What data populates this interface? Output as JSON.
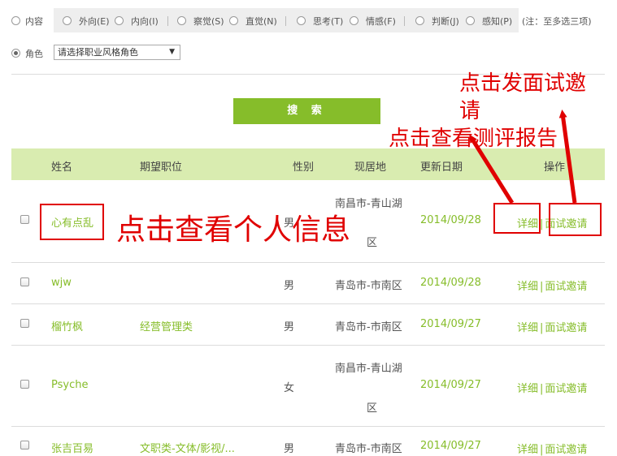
{
  "filter": {
    "content_label": "内容",
    "options": [
      "外向(E)",
      "内向(I)",
      "察觉(S)",
      "直觉(N)",
      "思考(T)",
      "情感(F)",
      "判断(J)",
      "感知(P)"
    ],
    "note": "(注：至多选三项)",
    "role_label": "角色",
    "role_select_value": "请选择职业风格角色"
  },
  "search_label": "搜 索",
  "table": {
    "headers": [
      "姓名",
      "期望职位",
      "性别",
      "现居地",
      "更新日期",
      "操作"
    ],
    "rows": [
      {
        "name": "心有点乱",
        "job": "",
        "gender": "男",
        "location_line1": "南昌市-青山湖",
        "location_line2": "区",
        "date": "2014/09/28",
        "detail": "详细",
        "invite": "面试邀请"
      },
      {
        "name": "wjw",
        "job": "",
        "gender": "男",
        "location": "青岛市-市南区",
        "date": "2014/09/28",
        "detail": "详细",
        "invite": "面试邀请"
      },
      {
        "name": "榴竹枫",
        "job": "经营管理类",
        "gender": "男",
        "location": "青岛市-市南区",
        "date": "2014/09/27",
        "detail": "详细",
        "invite": "面试邀请"
      },
      {
        "name": "Psyche",
        "job": "",
        "gender": "女",
        "location_line1": "南昌市-青山湖",
        "location_line2": "区",
        "date": "2014/09/27",
        "detail": "详细",
        "invite": "面试邀请"
      },
      {
        "name": "张吉百易",
        "job": "文职类-文体/影视/...",
        "gender": "男",
        "location": "青岛市-市南区",
        "date": "2014/09/27",
        "detail": "详细",
        "invite": "面试邀请"
      }
    ]
  },
  "annotations": {
    "personal_info": "点击查看个人信息",
    "send_invite_line1": "点击发面试邀",
    "send_invite_line2": "请",
    "view_report": "点击查看测评报告"
  },
  "colors": {
    "accent": "#86bd2a",
    "header_bg": "#d9ecb0",
    "annotation": "#e00000"
  }
}
